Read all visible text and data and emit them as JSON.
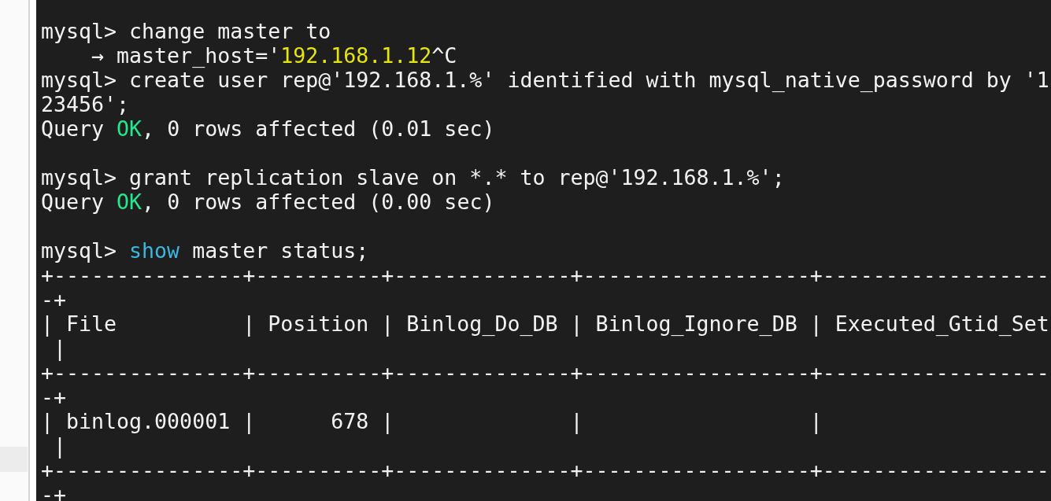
{
  "terminal": {
    "lines": [
      {
        "kind": "text",
        "segments": [
          {
            "kind": "plain",
            "text": "mysql> change master to"
          }
        ]
      },
      {
        "kind": "text",
        "segments": [
          {
            "kind": "plain",
            "text": "    → master_host='"
          },
          {
            "kind": "string",
            "text": "192.168.1.12"
          },
          {
            "kind": "plain",
            "text": "^C"
          }
        ]
      },
      {
        "kind": "text",
        "segments": [
          {
            "kind": "plain",
            "text": "mysql> create user rep@'192.168.1.%' identified with mysql_native_password by '1"
          }
        ]
      },
      {
        "kind": "text",
        "segments": [
          {
            "kind": "plain",
            "text": "23456';"
          }
        ]
      },
      {
        "kind": "text",
        "segments": [
          {
            "kind": "plain",
            "text": "Query "
          },
          {
            "kind": "status",
            "text": "OK"
          },
          {
            "kind": "plain",
            "text": ", 0 rows affected (0.01 sec)"
          }
        ]
      },
      {
        "kind": "blank"
      },
      {
        "kind": "text",
        "segments": [
          {
            "kind": "plain",
            "text": "mysql> grant replication slave on *.* to rep@'192.168.1.%';"
          }
        ]
      },
      {
        "kind": "text",
        "segments": [
          {
            "kind": "plain",
            "text": "Query "
          },
          {
            "kind": "status",
            "text": "OK"
          },
          {
            "kind": "plain",
            "text": ", 0 rows affected (0.00 sec)"
          }
        ]
      },
      {
        "kind": "blank"
      },
      {
        "kind": "text",
        "segments": [
          {
            "kind": "plain",
            "text": "mysql> "
          },
          {
            "kind": "keyword",
            "text": "show"
          },
          {
            "kind": "plain",
            "text": " master status;"
          }
        ]
      },
      {
        "kind": "text",
        "segments": [
          {
            "kind": "plain",
            "text": "+---------------+----------+--------------+------------------+------------------"
          }
        ]
      },
      {
        "kind": "text",
        "segments": [
          {
            "kind": "plain",
            "text": "-+"
          }
        ]
      },
      {
        "kind": "text",
        "segments": [
          {
            "kind": "plain",
            "text": "| File          | Position | Binlog_Do_DB | Binlog_Ignore_DB | Executed_Gtid_Set"
          }
        ]
      },
      {
        "kind": "text",
        "segments": [
          {
            "kind": "plain",
            "text": " |"
          }
        ]
      },
      {
        "kind": "text",
        "segments": [
          {
            "kind": "plain",
            "text": "+---------------+----------+--------------+------------------+------------------"
          }
        ]
      },
      {
        "kind": "text",
        "segments": [
          {
            "kind": "plain",
            "text": "-+"
          }
        ]
      },
      {
        "kind": "text",
        "segments": [
          {
            "kind": "plain",
            "text": "| binlog.000001 |      678 |              |                  |"
          }
        ]
      },
      {
        "kind": "text",
        "segments": [
          {
            "kind": "plain",
            "text": " |"
          }
        ]
      },
      {
        "kind": "text",
        "segments": [
          {
            "kind": "plain",
            "text": "+---------------+----------+--------------+------------------+------------------"
          }
        ]
      },
      {
        "kind": "text",
        "segments": [
          {
            "kind": "plain",
            "text": "-+"
          }
        ]
      }
    ]
  }
}
